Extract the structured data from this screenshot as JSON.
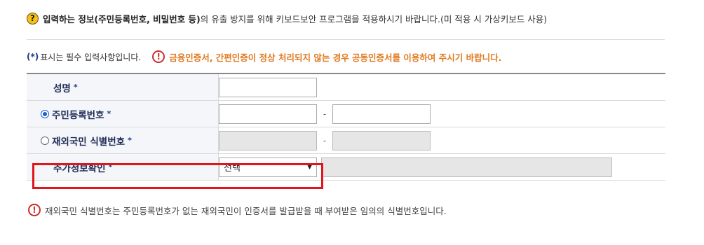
{
  "notice": {
    "bold": "입력하는 정보(주민등록번호, 비밀번호 등)",
    "rest": "의 유출 방지를 위해 키보드보안 프로그램을 적용하시기 바랍니다.(미 적용 시 가상키보드 사용)"
  },
  "required": {
    "mark": "(*)",
    "text": "표시는 필수 입력사항입니다.",
    "warning": "금융인증서, 간편인증이 정상 처리되지 않는 경우 공동인증서를 이용하여 주시기 바랍니다."
  },
  "form": {
    "star": "*",
    "name_label": "성명",
    "resident_label": "주민등록번호",
    "foreigner_label": "재외국민 식별번호",
    "extra_label": "추가정보확인",
    "dash": "-",
    "select_value": "선택"
  },
  "bottom_note": "재외국민 식별번호는 주민등록번호가 없는 재외국민이 인증서를 발급받을 때 부여받은 임의의 식별번호입니다.",
  "colors": {
    "highlight": "#e2141c",
    "warning": "#e07a20",
    "label": "#1e2a55"
  }
}
